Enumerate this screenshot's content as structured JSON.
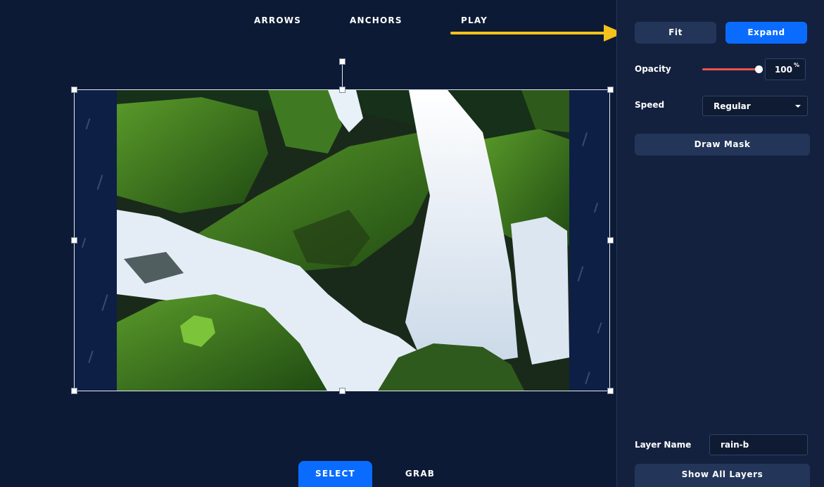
{
  "toolbar_top": {
    "modes": [
      {
        "id": "arrows",
        "label": "ARROWS"
      },
      {
        "id": "anchors",
        "label": "ANCHORS"
      },
      {
        "id": "play",
        "label": "PLAY"
      }
    ]
  },
  "toolbar_bottom": {
    "select_label": "SELECT",
    "grab_label": "GRAB",
    "active": "select"
  },
  "canvas": {
    "layer_image": "waterfall-over-mossy-rocks",
    "overlay_effect": "rain"
  },
  "annotation": {
    "arrow_color": "#f4c21a",
    "points_to": "fit-button"
  },
  "panel": {
    "fit_label": "Fit",
    "expand_label": "Expand",
    "opacity": {
      "label": "Opacity",
      "value": "100",
      "unit": "%",
      "fraction": 1.0
    },
    "speed": {
      "label": "Speed",
      "selected": "Regular"
    },
    "draw_mask_label": "Draw Mask",
    "layer_name": {
      "label": "Layer Name",
      "value": "rain-b"
    },
    "show_all_layers_label": "Show All Layers"
  },
  "colors": {
    "background": "#0c1a35",
    "panel": "#13213f",
    "accent": "#0a6cff",
    "secondary_button": "#233659",
    "slider_fill": "#f0524a"
  }
}
